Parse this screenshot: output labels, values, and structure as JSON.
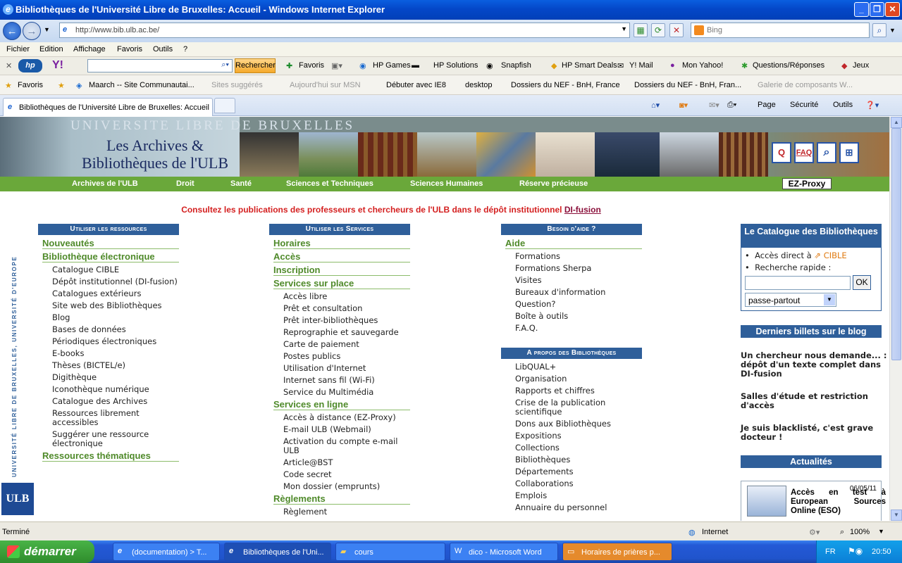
{
  "window": {
    "title": "Bibliothèques de l'Université Libre de Bruxelles: Accueil - Windows Internet Explorer"
  },
  "address": {
    "url": "http://www.bib.ulb.ac.be/",
    "search_placeholder": "Bing"
  },
  "menu": [
    "Fichier",
    "Edition",
    "Affichage",
    "Favoris",
    "Outils",
    "?"
  ],
  "toolbar": {
    "search_button": "Rechercher",
    "favoris": "Favoris",
    "items": [
      "HP Games",
      "HP Solutions",
      "Snapfish",
      "HP Smart Deals",
      "Y! Mail",
      "Mon Yahoo!",
      "Questions/Réponses",
      "Jeux"
    ]
  },
  "favorites": {
    "label": "Favoris",
    "items": [
      "Maarch -- Site Communautai...",
      "Sites suggérés",
      "Aujourd'hui sur MSN",
      "Débuter avec IE8",
      "desktop",
      "Dossiers du NEF - BnH, France",
      "Dossiers du NEF - BnH, Fran...",
      "Galerie de composants W..."
    ]
  },
  "tab": {
    "label": "Bibliothèques de l'Université Libre de Bruxelles: Accueil"
  },
  "commandbar": {
    "page": "Page",
    "securite": "Sécurité",
    "outils": "Outils"
  },
  "banner": {
    "university": "UNIVERSITE LIBRE DE BRUXELLES",
    "title": "Les Archives & Bibliothèques de l'ULB",
    "faq": "FAQ"
  },
  "nav": [
    "Archives de l'ULB",
    "Droit",
    "Santé",
    "Sciences et Techniques",
    "Sciences Humaines",
    "Réserve précieuse"
  ],
  "ezproxy": "EZ-Proxy",
  "announce": {
    "text": "Consultez les publications des professeurs et chercheurs de l'ULB dans le dépôt institutionnel ",
    "link": "DI-fusion"
  },
  "side_vertical": "UNIVERSITÉ LIBRE DE BRUXELLES, UNIVERSITÉ D'EUROPE",
  "logo": "ULB",
  "col1": {
    "head": "Utiliser les ressources",
    "s1": "Nouveautés",
    "s2": "Bibliothèque électronique",
    "items": [
      "Catalogue CIBLE",
      "Dépôt institutionnel (DI-fusion)",
      "Catalogues extérieurs",
      "Site web des Bibliothèques",
      "Blog",
      "Bases de données",
      "Périodiques électroniques",
      "E-books",
      "Thèses (BICTEL/e)",
      "Digithèque",
      "Iconothèque numérique",
      "Catalogue des Archives",
      "Ressources librement accessibles",
      "Suggérer une ressource électronique"
    ],
    "s3": "Ressources thématiques"
  },
  "col2": {
    "head": "Utiliser les Services",
    "s1": "Horaires",
    "s2": "Accès",
    "s3": "Inscription",
    "s4": "Services sur place",
    "items1": [
      "Accès libre",
      "Prêt et consultation",
      "Prêt inter-bibliothèques",
      "Reprographie et sauvegarde",
      "Carte de paiement",
      "Postes publics",
      "Utilisation d'Internet",
      "Internet sans fil (Wi-Fi)",
      "Service du Multimédia"
    ],
    "s5": "Services en ligne",
    "items2": [
      "Accès à distance (EZ-Proxy)",
      "E-mail ULB (Webmail)",
      "Activation du compte e-mail ULB",
      "Article@BST",
      "Code secret",
      "Mon dossier (emprunts)"
    ],
    "s6": "Règlements",
    "items3": [
      "Règlement"
    ]
  },
  "col3": {
    "head": "Besoin d'aide ?",
    "s1": "Aide",
    "items1": [
      "Formations",
      "Formations Sherpa",
      "Visites",
      "Bureaux d'information",
      "Question?",
      "Boîte à outils",
      "F.A.Q."
    ],
    "head2": "A propos des Bibliothèques",
    "items2": [
      "LibQUAL+",
      "Organisation",
      "Rapports et chiffres",
      "Crise de la publication scientifique",
      "Dons aux Bibliothèques",
      "Expositions",
      "Collections",
      "Bibliothèques",
      "Départements",
      "Collaborations",
      "Emplois",
      "Annuaire du personnel"
    ]
  },
  "catalogue": {
    "head": "Le Catalogue des Bibliothèques",
    "direct": "Accès direct à",
    "cible": "CIBLE",
    "rapide": "Recherche rapide :",
    "ok": "OK",
    "select": "passe-partout"
  },
  "blog": {
    "head": "Derniers billets sur le blog",
    "posts": [
      "Un chercheur nous demande... : dépôt d'un texte complet dans DI-fusion",
      "Salles d'étude et restriction d'accès",
      "Je suis blacklisté, c'est grave docteur !"
    ]
  },
  "actualites": {
    "head": "Actualités",
    "date": "06/05/11",
    "text": "Accès en test à European Sources Online (ESO)"
  },
  "status": {
    "left": "Terminé",
    "zone": "Internet",
    "zoom": "100%"
  },
  "taskbar": {
    "start": "démarrer",
    "tasks": [
      "(documentation) > T...",
      "Bibliothèques de l'Uni...",
      "cours",
      "dico - Microsoft Word",
      "Horaires de prières p..."
    ],
    "lang": "FR",
    "clock": "20:50"
  },
  "colors": {
    "accent_blue": "#2f5f9a",
    "green": "#6aa83a",
    "red": "#d42020"
  }
}
